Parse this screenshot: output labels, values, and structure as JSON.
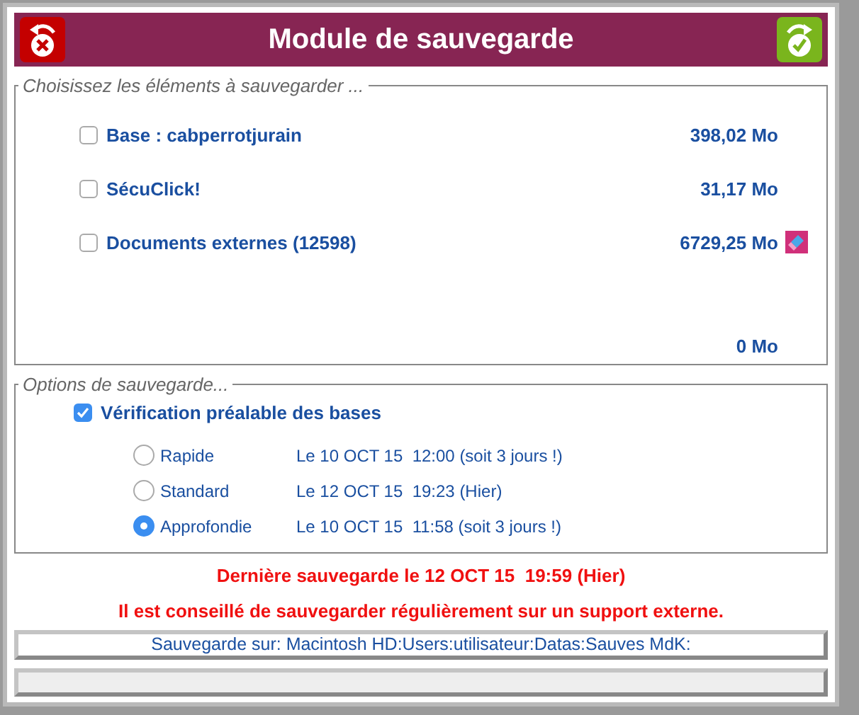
{
  "window": {
    "title": "Module de sauvegarde"
  },
  "elements": {
    "legend": "Choisissez les éléments à sauvegarder ...",
    "items": [
      {
        "label": "Base : cabperrotjurain",
        "size": "398,02 Mo",
        "checked": false,
        "has_erase": false
      },
      {
        "label": "SécuClick!",
        "size": "31,17 Mo",
        "checked": false,
        "has_erase": false
      },
      {
        "label": "Documents externes (12598)",
        "size": "6729,25 Mo",
        "checked": false,
        "has_erase": true
      }
    ],
    "total": "0 Mo"
  },
  "options": {
    "legend": "Options de sauvegarde...",
    "verify": {
      "label": "Vérification préalable des bases",
      "checked": true
    },
    "modes": [
      {
        "label": "Rapide",
        "date": "Le 10 OCT 15  12:00 (soit 3 jours !)",
        "selected": false
      },
      {
        "label": "Standard",
        "date": "Le 12 OCT 15  19:23 (Hier)",
        "selected": false
      },
      {
        "label": "Approfondie",
        "date": "Le 10 OCT 15  11:58 (soit 3 jours !)",
        "selected": true
      }
    ]
  },
  "warnings": [
    "Dernière sauvegarde le 12 OCT 15  19:59 (Hier)",
    "Il est conseillé de sauvegarder régulièrement sur un support externe."
  ],
  "destination": "Sauvegarde sur: Macintosh HD:Users:utilisateur:Datas:Sauves MdK:"
}
